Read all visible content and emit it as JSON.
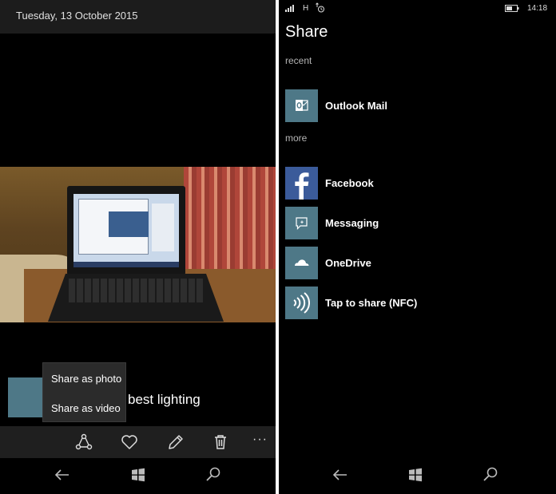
{
  "photos": {
    "date": "Tuesday, 13 October 2015",
    "caption": "best lighting",
    "share_menu": {
      "items": [
        "Share as photo",
        "Share as video"
      ]
    },
    "appbar": {
      "more": "···"
    }
  },
  "share": {
    "status": {
      "network": "H",
      "time": "14:18"
    },
    "title": "Share",
    "sections": {
      "recent": "recent",
      "more": "more"
    },
    "recent_items": [
      {
        "label": "Outlook Mail",
        "icon": "outlook-icon"
      }
    ],
    "more_items": [
      {
        "label": "Facebook",
        "icon": "facebook-icon"
      },
      {
        "label": "Messaging",
        "icon": "messaging-icon"
      },
      {
        "label": "OneDrive",
        "icon": "onedrive-icon"
      },
      {
        "label": "Tap to share (NFC)",
        "icon": "nfc-icon"
      }
    ]
  },
  "colors": {
    "tile": "#4e7887",
    "facebook": "#3b5b9a",
    "appbar": "#1f1f1f",
    "popup": "#2b2b2b"
  }
}
